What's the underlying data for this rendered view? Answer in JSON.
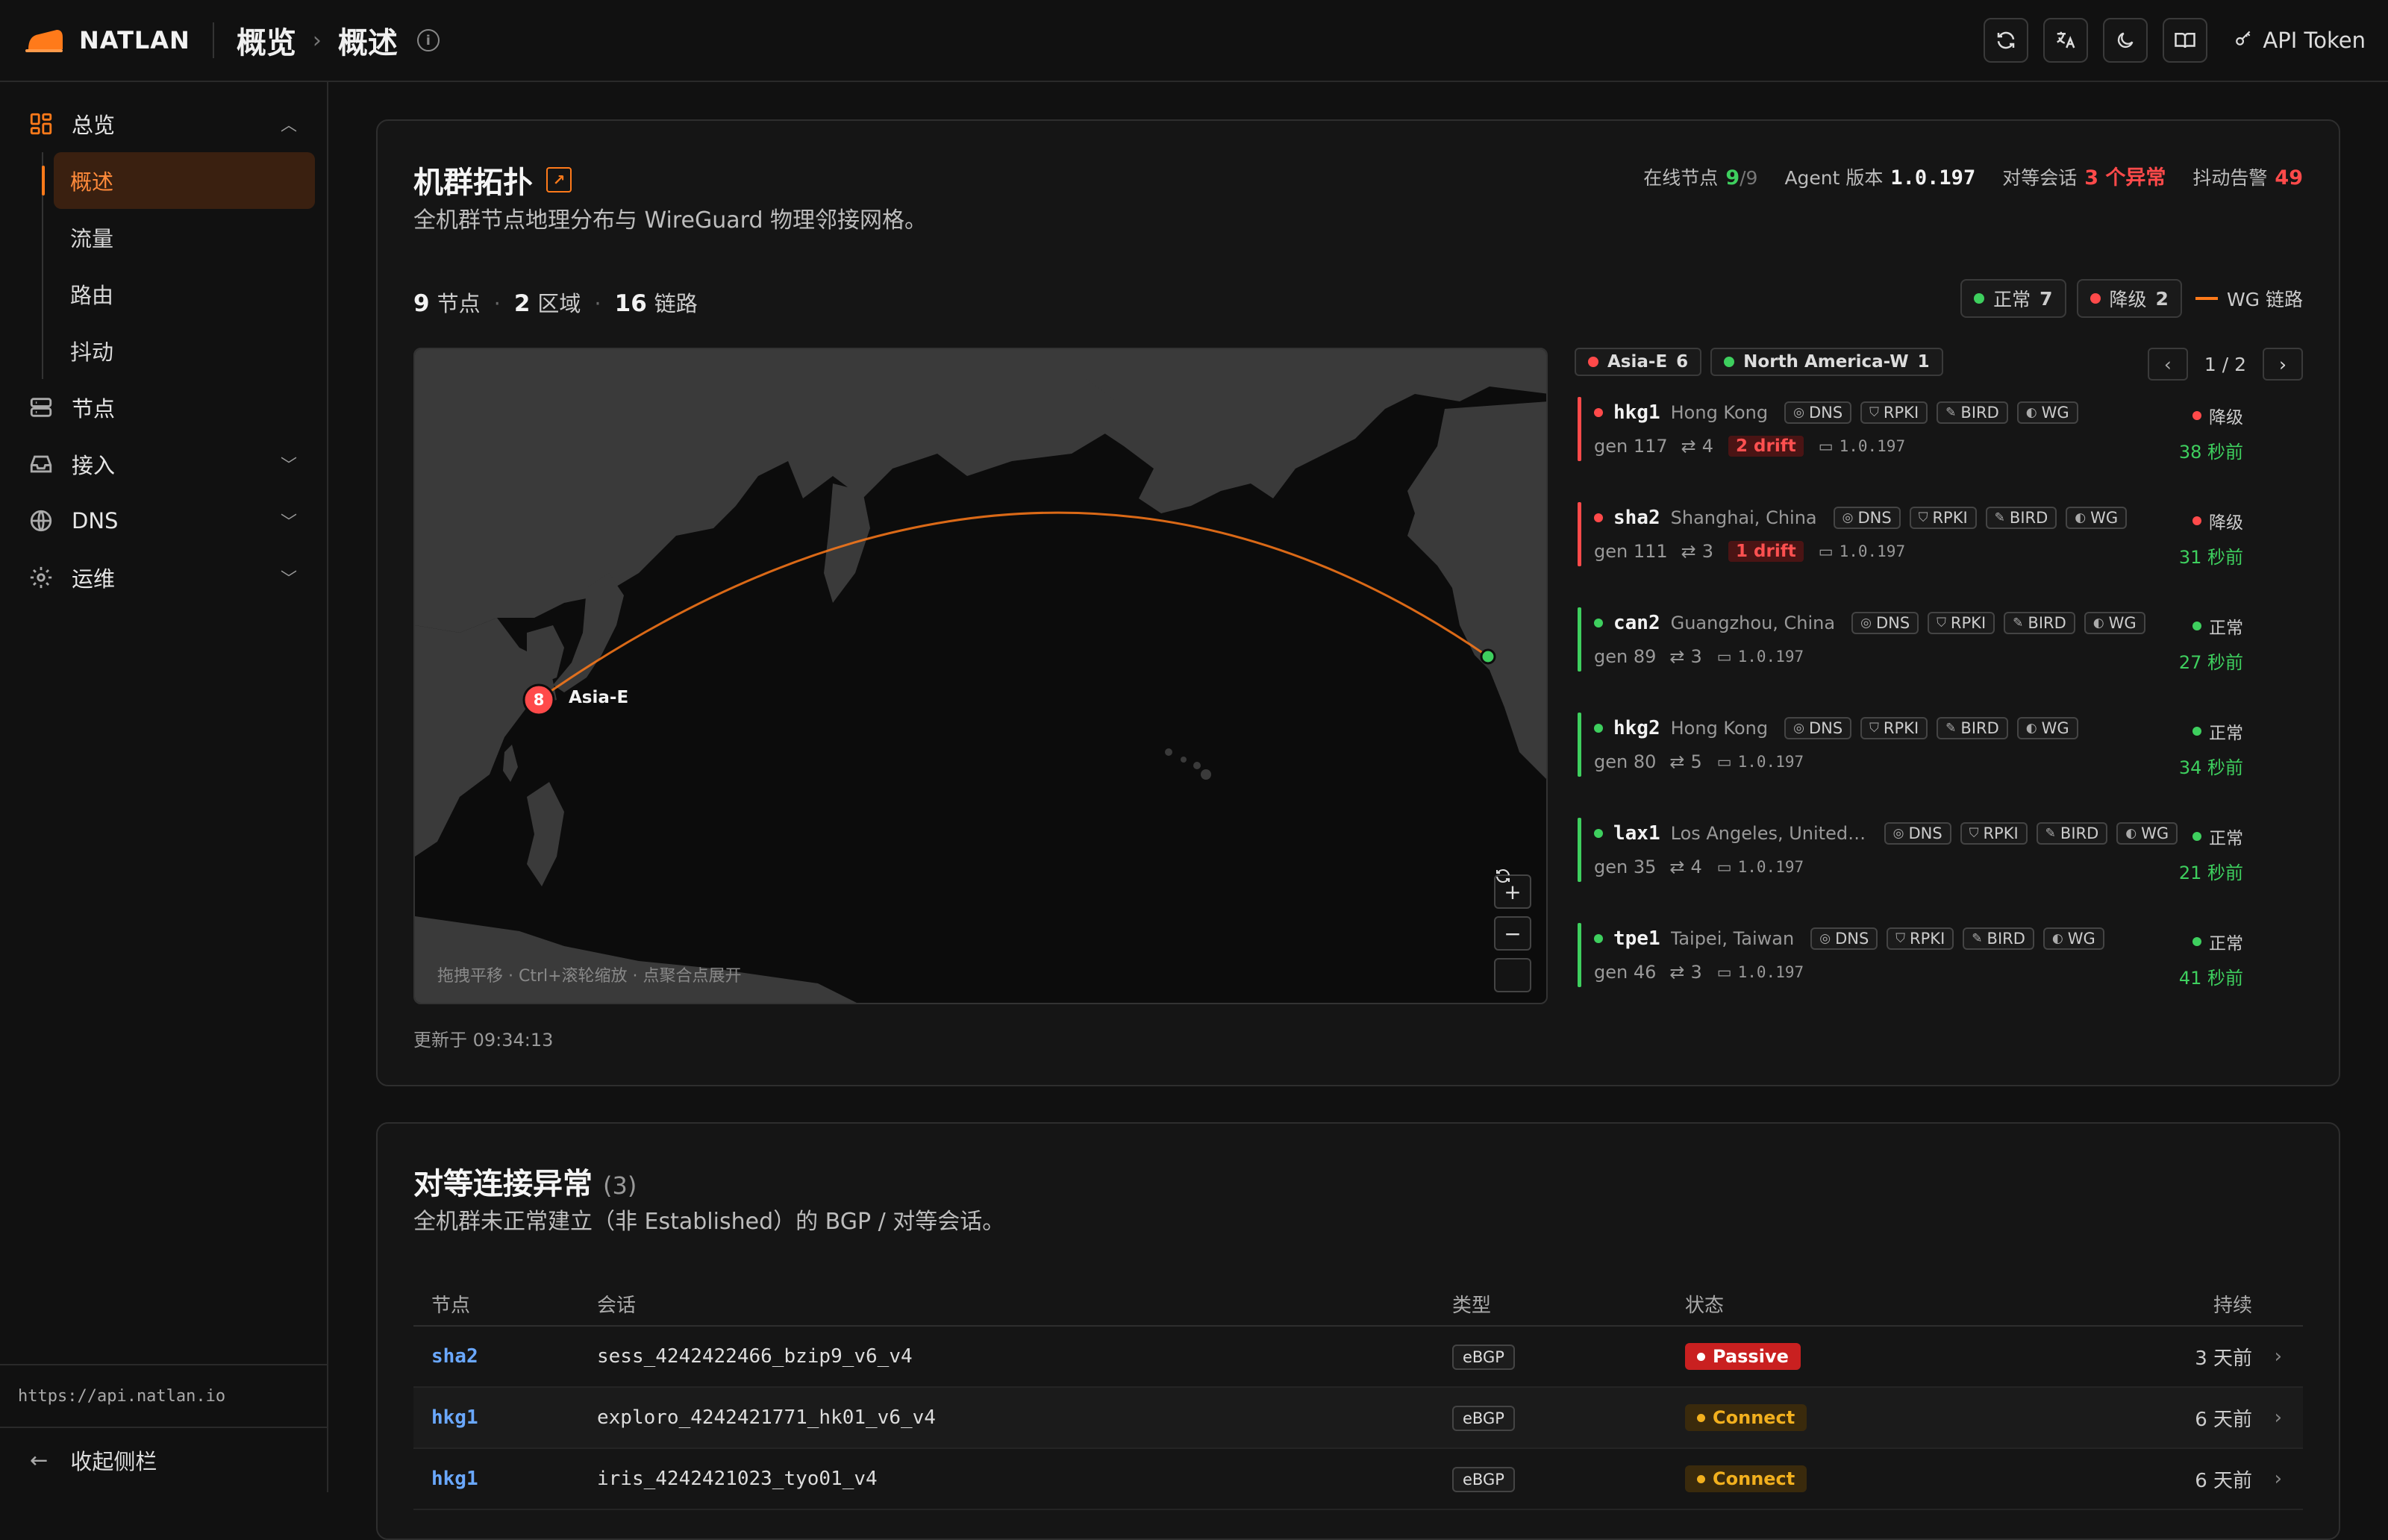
{
  "header": {
    "brand": "NATLAN",
    "crumb1": "概览",
    "crumb_sep": "›",
    "crumb2": "概述",
    "api_token": "API Token"
  },
  "sidebar": {
    "groups": [
      {
        "label": "总览",
        "icon": "dashboard-icon"
      },
      {
        "label": "节点",
        "icon": "server-icon"
      },
      {
        "label": "接入",
        "icon": "inbox-icon"
      },
      {
        "label": "DNS",
        "icon": "globe-icon"
      },
      {
        "label": "运维",
        "icon": "gear-icon"
      }
    ],
    "sub_items": [
      "概述",
      "流量",
      "路由",
      "抖动"
    ],
    "api_url": "https://api.natlan.io",
    "collapse": "收起侧栏"
  },
  "topology": {
    "title": "机群拓扑",
    "subtitle": "全机群节点地理分布与 WireGuard 物理邻接网格。",
    "stats": {
      "online_label": "在线节点",
      "online_value": "9",
      "online_total": "/9",
      "agent_label": "Agent 版本",
      "agent_value": "1.0.197",
      "peer_label": "对等会话",
      "peer_value": "3 个异常",
      "jitter_label": "抖动告警",
      "jitter_value": "49"
    },
    "counts": {
      "nodes_num": "9",
      "nodes_label": "节点",
      "regions_num": "2",
      "regions_label": "区域",
      "links_num": "16",
      "links_label": "链路"
    },
    "legend": {
      "normal_label": "正常",
      "normal_count": "7",
      "degraded_label": "降级",
      "degraded_count": "2",
      "wg_label": "WG 链路"
    },
    "map": {
      "cluster_count": "8",
      "cluster_label": "Asia-E",
      "hint": "拖拽平移 · Ctrl+滚轮缩放 · 点聚合点展开",
      "zoom_in": "+",
      "zoom_out": "−"
    },
    "updated": "更新于 09:34:13",
    "region_tabs": [
      {
        "label": "Asia-E",
        "count": "6",
        "color": "#ff4a4a"
      },
      {
        "label": "North America-W",
        "count": "1",
        "color": "#3ecf5e"
      }
    ],
    "pager": "1 / 2",
    "nodes": [
      {
        "name": "hkg1",
        "loc": "Hong Kong",
        "gen": "gen 117",
        "peers": "4",
        "drift": "2 drift",
        "ver": "1.0.197",
        "status": "降级",
        "time": "38 秒前",
        "ok": false
      },
      {
        "name": "sha2",
        "loc": "Shanghai, China",
        "gen": "gen 111",
        "peers": "3",
        "drift": "1 drift",
        "ver": "1.0.197",
        "status": "降级",
        "time": "31 秒前",
        "ok": false
      },
      {
        "name": "can2",
        "loc": "Guangzhou, China",
        "gen": "gen 89",
        "peers": "3",
        "drift": "",
        "ver": "1.0.197",
        "status": "正常",
        "time": "27 秒前",
        "ok": true
      },
      {
        "name": "hkg2",
        "loc": "Hong Kong",
        "gen": "gen 80",
        "peers": "5",
        "drift": "",
        "ver": "1.0.197",
        "status": "正常",
        "time": "34 秒前",
        "ok": true
      },
      {
        "name": "lax1",
        "loc": "Los Angeles, United ...",
        "gen": "gen 35",
        "peers": "4",
        "drift": "",
        "ver": "1.0.197",
        "status": "正常",
        "time": "21 秒前",
        "ok": true
      },
      {
        "name": "tpe1",
        "loc": "Taipei, Taiwan",
        "gen": "gen 46",
        "peers": "3",
        "drift": "",
        "ver": "1.0.197",
        "status": "正常",
        "time": "41 秒前",
        "ok": true
      }
    ],
    "tags": [
      "DNS",
      "RPKI",
      "BIRD",
      "WG"
    ]
  },
  "peers": {
    "title": "对等连接异常",
    "count": "(3)",
    "subtitle": "全机群未正常建立（非 Established）的 BGP / 对等会话。",
    "columns": {
      "node": "节点",
      "session": "会话",
      "type": "类型",
      "status": "状态",
      "duration": "持续"
    },
    "rows": [
      {
        "node": "sha2",
        "session": "sess_4242422466_bzip9_v6_v4",
        "type": "eBGP",
        "status": "Passive",
        "duration": "3 天前"
      },
      {
        "node": "hkg1",
        "session": "exploro_4242421771_hk01_v6_v4",
        "type": "eBGP",
        "status": "Connect",
        "duration": "6 天前"
      },
      {
        "node": "hkg1",
        "session": "iris_4242421023_tyo01_v4",
        "type": "eBGP",
        "status": "Connect",
        "duration": "6 天前"
      }
    ]
  },
  "colors": {
    "accent": "#ff7a1a",
    "ok": "#3ecf5e",
    "bad": "#ff4a4a",
    "link": "#6aa8ff"
  }
}
